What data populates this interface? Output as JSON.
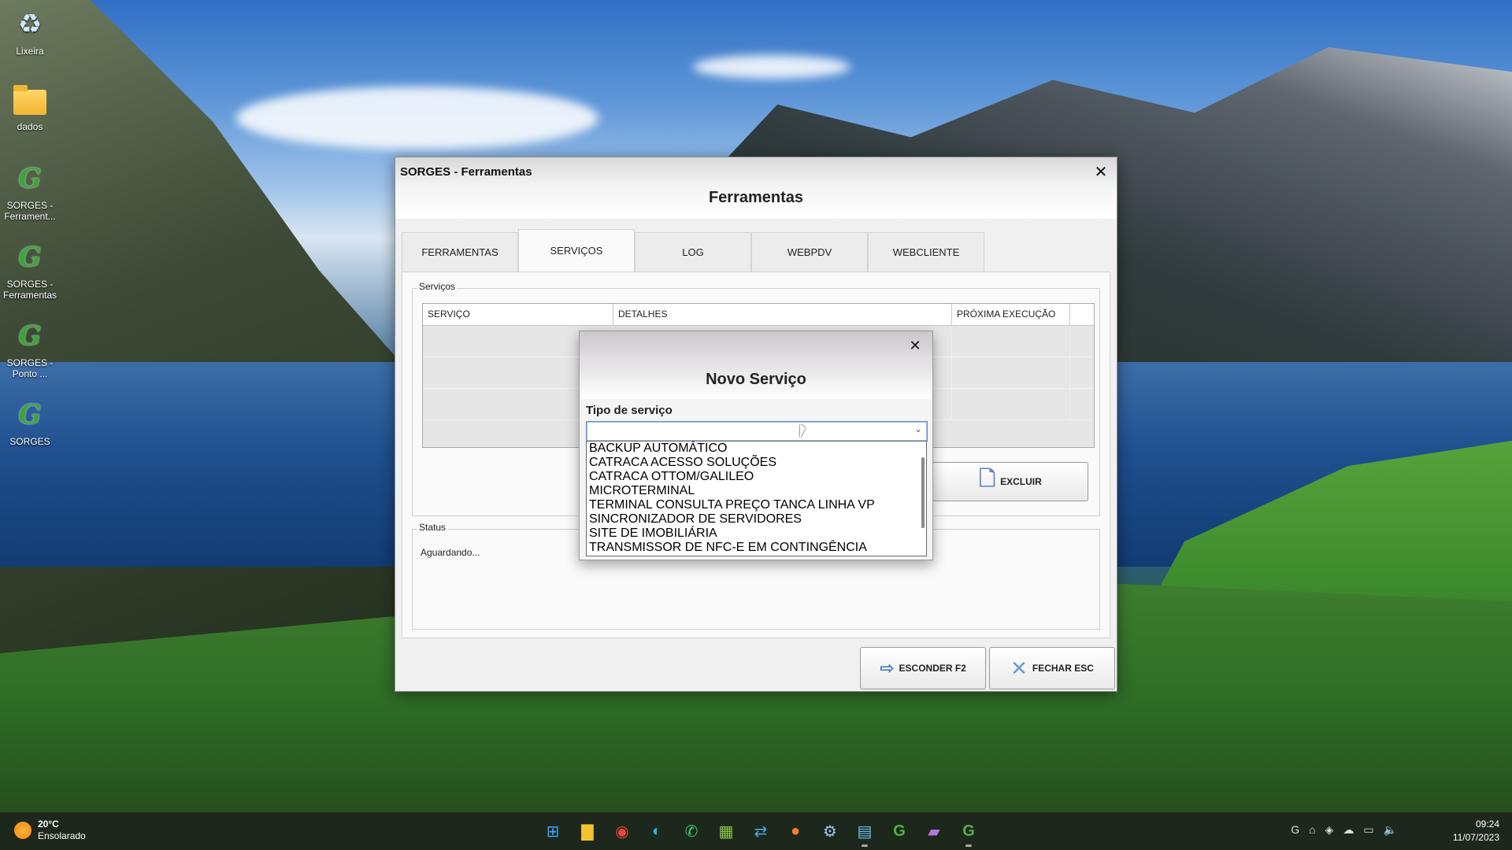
{
  "desktop": {
    "icons": [
      {
        "label": "Lixeira",
        "icon": "recycle-bin-icon"
      },
      {
        "label": "dados",
        "icon": "folder-icon"
      },
      {
        "label": "SORGES - Ferrament...",
        "icon": "sorges-shortcut-icon"
      },
      {
        "label": "SORGES - Ferramentas",
        "icon": "sorges-shortcut-icon"
      },
      {
        "label": "SORGES - Ponto ...",
        "icon": "sorges-shortcut-icon"
      },
      {
        "label": "SORGES",
        "icon": "sorges-shortcut-icon"
      }
    ]
  },
  "window": {
    "title": "SORGES - Ferramentas",
    "header": "Ferramentas",
    "tabs": [
      {
        "label": "FERRAMENTAS"
      },
      {
        "label": "SERVIÇOS",
        "active": true
      },
      {
        "label": "LOG"
      },
      {
        "label": "WEBPDV"
      },
      {
        "label": "WEBCLIENTE"
      }
    ],
    "services_group": "Serviços",
    "columns": [
      "SERVIÇO",
      "DETALHES",
      "PRÓXIMA EXECUÇÃO"
    ],
    "delete_button": "EXCLUIR",
    "status_group": "Status",
    "status_text": "Aguardando...",
    "hide_button": "ESCONDER F2",
    "close_button": "FECHAR ESC"
  },
  "modal": {
    "title": "Novo Serviço",
    "field_label": "Tipo de serviço",
    "selected_value": "",
    "options": [
      "BACKUP AUTOMÁTICO",
      "CATRACA ACESSO SOLUÇÕES",
      "CATRACA OTTOM/GALILEO",
      "MICROTERMINAL",
      "TERMINAL CONSULTA PREÇO TANCA LINHA VP",
      "SINCRONIZADOR DE SERVIDORES",
      "SITE DE IMOBILIÁRIA",
      "TRANSMISSOR DE NFC-E EM CONTINGÊNCIA"
    ]
  },
  "taskbar": {
    "weather_temp": "20°C",
    "weather_desc": "Ensolarado",
    "time": "09:24",
    "date": "11/07/2023",
    "accent": "#0a64c8"
  }
}
